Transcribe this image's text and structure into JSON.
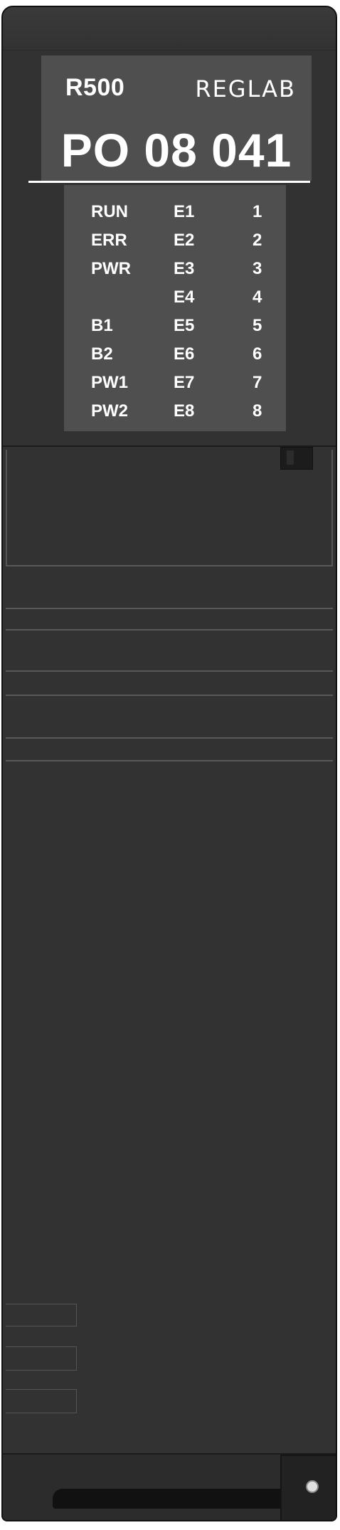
{
  "header": {
    "model": "R500",
    "brand": "REGLAB",
    "code": "PO 08 041"
  },
  "leds": [
    {
      "status": "RUN",
      "input": "E1",
      "channel": "1"
    },
    {
      "status": "ERR",
      "input": "E2",
      "channel": "2"
    },
    {
      "status": "PWR",
      "input": "E3",
      "channel": "3"
    },
    {
      "status": "",
      "input": "E4",
      "channel": "4"
    },
    {
      "status": "B1",
      "input": "E5",
      "channel": "5"
    },
    {
      "status": "B2",
      "input": "E6",
      "channel": "6"
    },
    {
      "status": "PW1",
      "input": "E7",
      "channel": "7"
    },
    {
      "status": "PW2",
      "input": "E8",
      "channel": "8"
    }
  ],
  "colors": {
    "housing": "#323232",
    "label_panel": "#4f4f4f",
    "text": "#ffffff"
  }
}
